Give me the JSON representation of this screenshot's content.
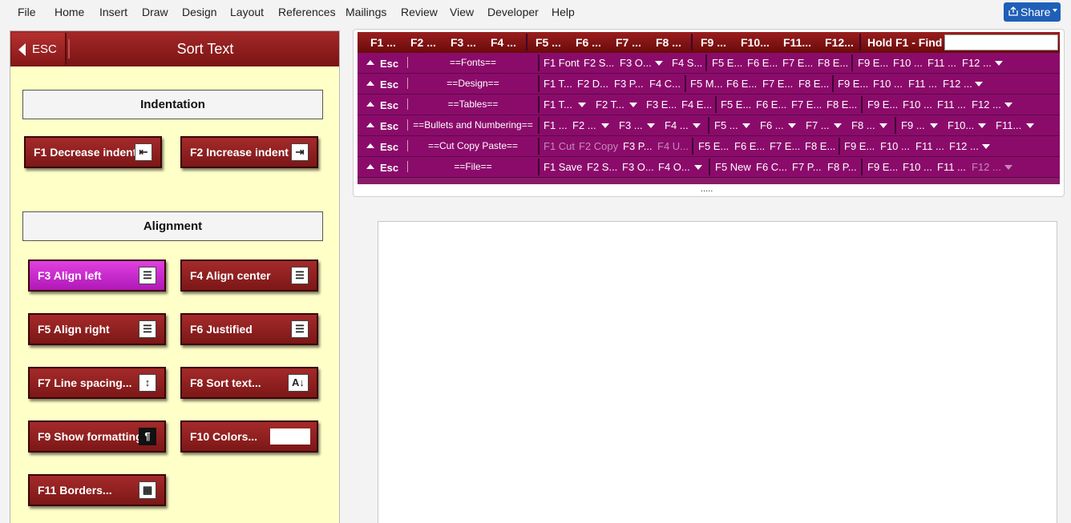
{
  "menubar": {
    "items": [
      "File",
      "Home",
      "Insert",
      "Draw",
      "Design",
      "Layout",
      "References",
      "Mailings",
      "Review",
      "View",
      "Developer",
      "Help"
    ],
    "share_label": "Share"
  },
  "panel": {
    "esc_label": "ESC",
    "title": "Sort Text",
    "sections": [
      "Indentation",
      "Alignment"
    ],
    "buttons": [
      {
        "label": "F1 Decrease indent",
        "icon": "decrease-indent-icon",
        "glyph": "⇤"
      },
      {
        "label": "F2 Increase indent",
        "icon": "increase-indent-icon",
        "glyph": "⇥"
      },
      {
        "label": "F3 Align left",
        "icon": "align-left-icon",
        "glyph": "☰",
        "active": true
      },
      {
        "label": "F4 Align center",
        "icon": "align-center-icon",
        "glyph": "☰"
      },
      {
        "label": "F5 Align right",
        "icon": "align-right-icon",
        "glyph": "☰"
      },
      {
        "label": "F6 Justified",
        "icon": "justify-icon",
        "glyph": "☰"
      },
      {
        "label": "F7 Line spacing...",
        "icon": "line-spacing-icon",
        "glyph": "↕"
      },
      {
        "label": "F8 Sort text...",
        "icon": "sort-az-icon",
        "glyph": "A↓"
      },
      {
        "label": "F9 Show formatting",
        "icon": "pilcrow-icon",
        "glyph": "¶"
      },
      {
        "label": "F10 Colors...",
        "icon": "color-swatch",
        "glyph": ""
      },
      {
        "label": "F11 Borders...",
        "icon": "borders-icon",
        "glyph": "▦"
      }
    ]
  },
  "toolbar": {
    "top": [
      "F1 ...",
      "F2 ...",
      "F3 ...",
      "F4 ...",
      "F5 ...",
      "F6 ...",
      "F7 ...",
      "F8 ...",
      "F9 ...",
      "F10...",
      "F11...",
      "F12...",
      "Hold F1 - Find"
    ],
    "esc_label": "Esc",
    "rows": [
      {
        "group": "==Fonts==",
        "cells": [
          "F1 Font",
          "F2 S...",
          "F3 O...",
          "F4 S...",
          "F5 E...",
          "F6 E...",
          "F7 E...",
          "F8 E...",
          "F9 E...",
          "F10 ...",
          "F11 ...",
          "F12 ..."
        ]
      },
      {
        "group": "==Design==",
        "cells": [
          "F1 T...",
          "F2 D...",
          "F3 P...",
          "F4 C...",
          "F5 M...",
          "F6 E...",
          "F7 E...",
          "F8 E...",
          "F9 E...",
          "F10 ...",
          "F11 ...",
          "F12 ..."
        ]
      },
      {
        "group": "==Tables==",
        "cells": [
          "F1 T...",
          "F2 T...",
          "F3 E...",
          "F4 E...",
          "F5 E...",
          "F6 E...",
          "F7 E...",
          "F8 E...",
          "F9 E...",
          "F10 ...",
          "F11 ...",
          "F12 ..."
        ]
      },
      {
        "group": "==Bullets and Numbering==",
        "cells": [
          "F1 ...",
          "F2 ...",
          "F3 ...",
          "F4 ...",
          "F5 ...",
          "F6 ...",
          "F7 ...",
          "F8 ...",
          "F9 ...",
          "F10...",
          "F11..."
        ]
      },
      {
        "group": "==Cut Copy Paste==",
        "cells": [
          "F1 Cut",
          "F2 Copy",
          "F3 P...",
          "F4 U...",
          "F5 E...",
          "F6 E...",
          "F7 E...",
          "F8 E...",
          "F9 E...",
          "F10 ...",
          "F11 ...",
          "F12 ..."
        ]
      },
      {
        "group": "==File==",
        "cells": [
          "F1 Save",
          "F2 S...",
          "F3 O...",
          "F4 O...",
          "F5 New",
          "F6 C...",
          "F7 P...",
          "F8 P...",
          "F9 E...",
          "F10 ...",
          "F11 ...",
          "F12 ..."
        ]
      }
    ],
    "dots": "....."
  }
}
